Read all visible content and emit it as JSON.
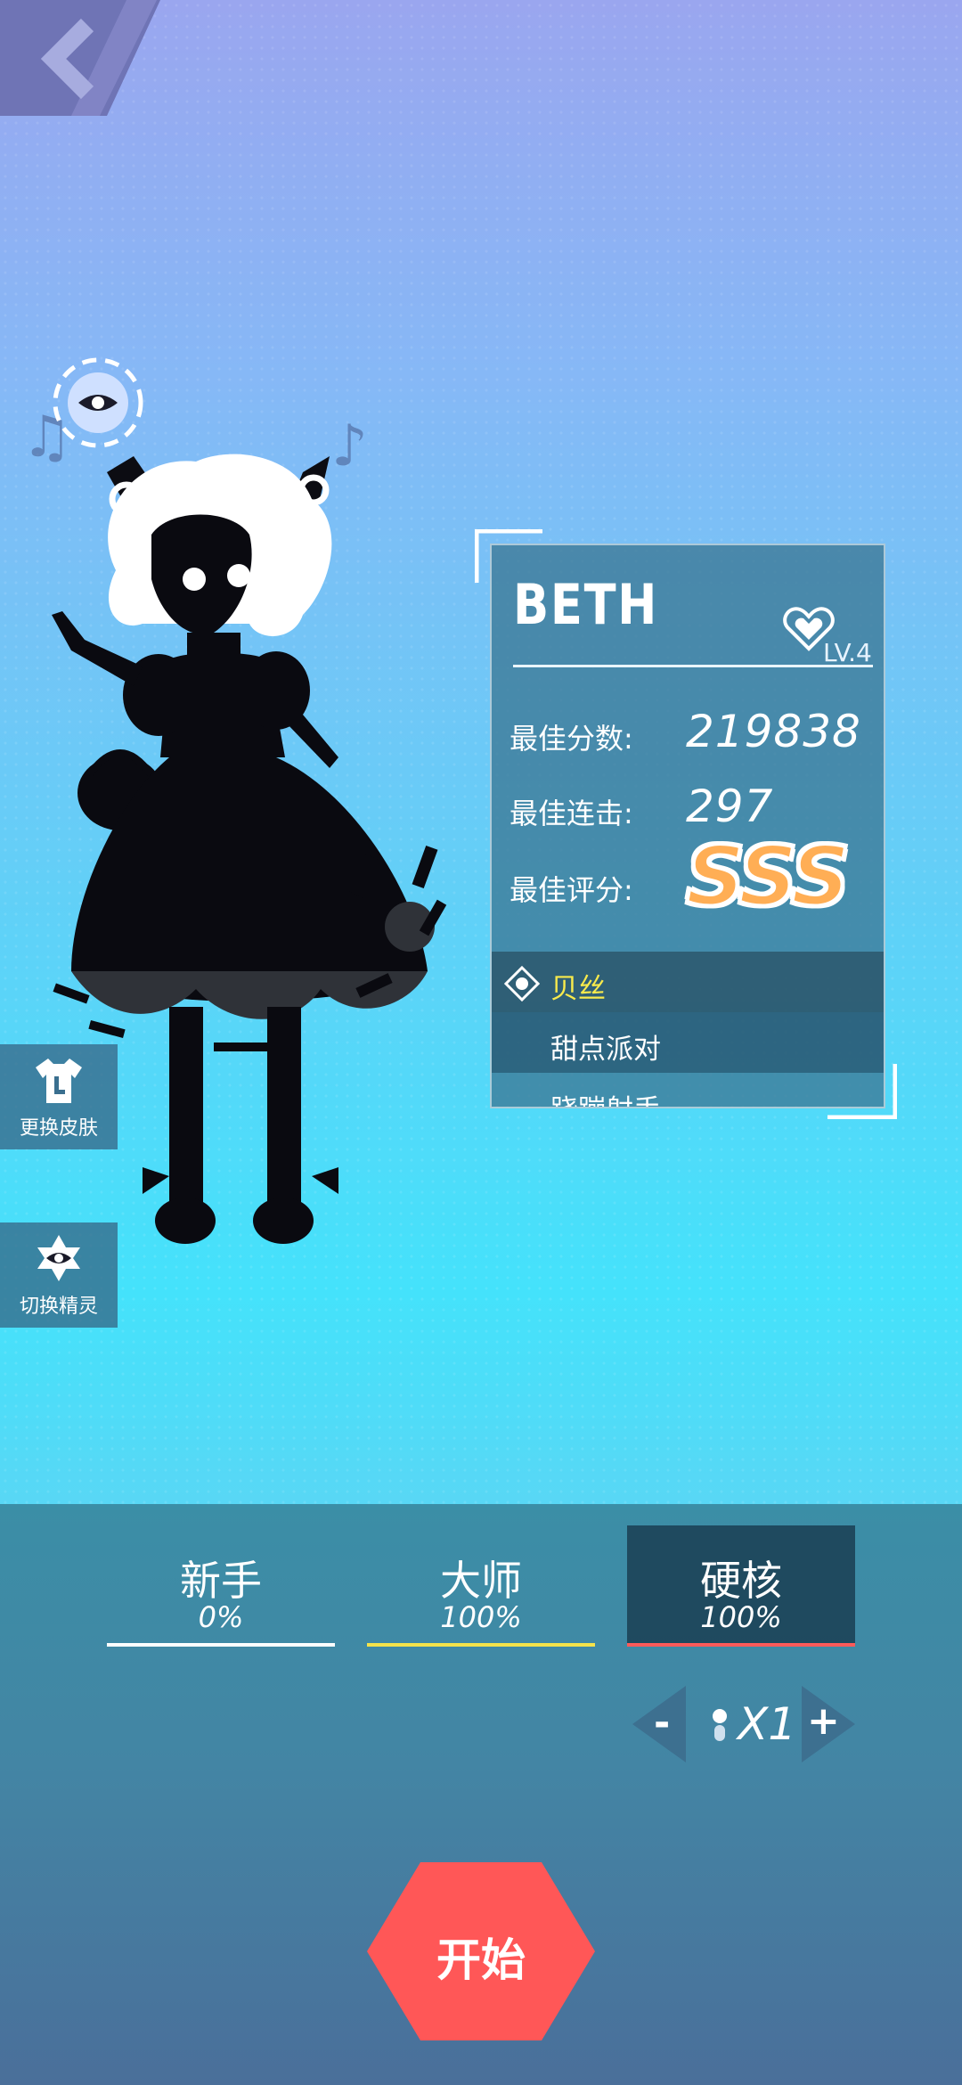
{
  "nav": {
    "back_icon": "chevron-left-icon"
  },
  "pet": {
    "icon": "eye-icon",
    "notes": [
      "♫",
      "♪"
    ]
  },
  "side_buttons": [
    {
      "label": "更换皮肤",
      "icon": "shirt-icon"
    },
    {
      "label": "切换精灵",
      "icon": "eye-icon"
    }
  ],
  "character": {
    "name": "BETH",
    "level": "LV.4",
    "stats": [
      {
        "label": "最佳分数:",
        "value": "219838"
      },
      {
        "label": "最佳连击:",
        "value": "297"
      },
      {
        "label": "最佳评分:",
        "value": ""
      }
    ],
    "grade": "SSS",
    "skins": [
      "贝丝",
      "甜点派对",
      "跷蹦射手"
    ]
  },
  "difficulties": [
    {
      "name": "新手",
      "percent": "0%",
      "color": "#ffffff",
      "active": false
    },
    {
      "name": "大师",
      "percent": "100%",
      "color": "#f4e34a",
      "active": false
    },
    {
      "name": "硬核",
      "percent": "100%",
      "color": "#ff5a5a",
      "active": true
    }
  ],
  "speed": {
    "value": "X1",
    "minus": "-",
    "plus": "+"
  },
  "start": {
    "label": "开始",
    "color": "#ff5757"
  },
  "colors": {
    "accent": "#ff5757",
    "highlight": "#f8ea4c",
    "panel": "#3c7896"
  }
}
